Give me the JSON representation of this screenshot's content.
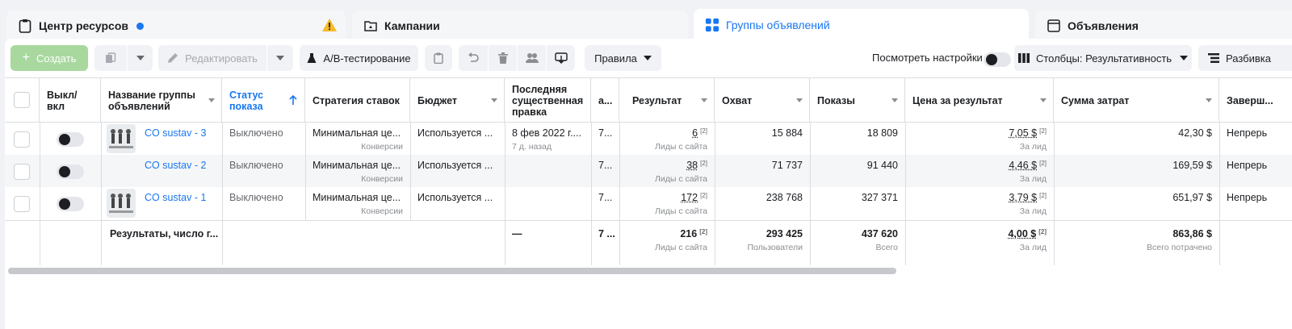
{
  "tabs": [
    {
      "label": "Центр ресурсов",
      "icon": "clipboard-icon"
    },
    {
      "label": "Кампании",
      "icon": "folder-icon"
    },
    {
      "label": "Группы объявлений",
      "icon": "grid-icon"
    },
    {
      "label": "Объявления",
      "icon": "ad-icon"
    }
  ],
  "toolbar": {
    "create_label": "Создать",
    "edit_label": "Редактировать",
    "ab_label": "A/B-тестирование",
    "rules_label": "Правила",
    "view_settings_label": "Посмотреть настройки",
    "columns_label": "Столбцы: Результативность",
    "breakdown_label": "Разбивка"
  },
  "table": {
    "headers": {
      "onoff": "Выкл/ вкл",
      "name": "Название группы объявлений",
      "status": "Статус показа",
      "strategy": "Стратегия ставок",
      "budget": "Бюджет",
      "last_edit": "Последняя существенная правка",
      "attr": "a...",
      "result": "Результат",
      "reach": "Охват",
      "impressions": "Показы",
      "cost_per_result": "Цена за результат",
      "spent": "Сумма затрат",
      "ends": "Заверш..."
    },
    "rows": [
      {
        "name": "CO sustav - 3",
        "status": "Выключено",
        "strategy": "Минимальная це...",
        "strategy_sub": "Конверсии",
        "budget": "Используется ...",
        "last_edit": "8 фев 2022 г....",
        "last_edit_sub": "7 д. назад",
        "attr": "7...",
        "result": "6",
        "result_sub": "Лиды с сайта",
        "reach": "15 884",
        "impressions": "18 809",
        "cost": "7,05 $",
        "cost_sub": "За лид",
        "spent": "42,30 $",
        "ends": "Непрерь",
        "note": "[2]"
      },
      {
        "name": "CO sustav - 2",
        "status": "Выключено",
        "strategy": "Минимальная це...",
        "strategy_sub": "Конверсии",
        "budget": "Используется ...",
        "last_edit": "",
        "last_edit_sub": "",
        "attr": "7...",
        "result": "38",
        "result_sub": "Лиды с сайта",
        "reach": "71 737",
        "impressions": "91 440",
        "cost": "4,46 $",
        "cost_sub": "За лид",
        "spent": "169,59 $",
        "ends": "Непрерь",
        "note": "[2]"
      },
      {
        "name": "CO sustav - 1",
        "status": "Выключено",
        "strategy": "Минимальная це...",
        "strategy_sub": "Конверсии",
        "budget": "Используется ...",
        "last_edit": "",
        "last_edit_sub": "",
        "attr": "7...",
        "result": "172",
        "result_sub": "Лиды с сайта",
        "reach": "238 768",
        "impressions": "327 371",
        "cost": "3,79 $",
        "cost_sub": "За лид",
        "spent": "651,97 $",
        "ends": "Непрерь",
        "note": "[2]"
      }
    ],
    "totals": {
      "label": "Результаты, число г...",
      "last_edit": "—",
      "attr": "7 ...",
      "result": "216",
      "result_sub": "Лиды с сайта",
      "reach": "293 425",
      "reach_sub": "Пользователи",
      "impressions": "437 620",
      "impressions_sub": "Всего",
      "cost": "4,00 $",
      "cost_sub": "За лид",
      "spent": "863,86 $",
      "spent_sub": "Всего потрачено",
      "note": "[2]"
    }
  },
  "colors": {
    "accent": "#1877f2",
    "create_button": "#a8d89d",
    "warning": "#f7b928"
  }
}
